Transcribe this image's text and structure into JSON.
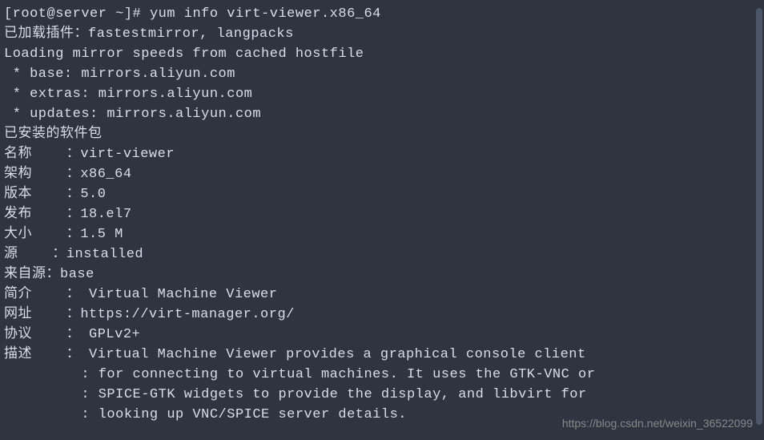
{
  "prompt": {
    "user_host": "[root@server ~]# ",
    "command": "yum info virt-viewer.x86_64"
  },
  "output": {
    "plugins_loaded": "已加载插件：fastestmirror, langpacks",
    "loading_mirror": "Loading mirror speeds from cached hostfile",
    "mirror_base": " * base: mirrors.aliyun.com",
    "mirror_extras": " * extras: mirrors.aliyun.com",
    "mirror_updates": " * updates: mirrors.aliyun.com",
    "installed_header": "已安装的软件包",
    "name_label": "名称    ：",
    "name_value": "virt-viewer",
    "arch_label": "架构    ：",
    "arch_value": "x86_64",
    "version_label": "版本    ：",
    "version_value": "5.0",
    "release_label": "发布    ：",
    "release_value": "18.el7",
    "size_label": "大小    ：",
    "size_value": "1.5 M",
    "source_label": "源    ：",
    "source_value": "installed",
    "from_source_label": "来自源：",
    "from_source_value": "base",
    "summary_label": "简介    ： ",
    "summary_value": "Virtual Machine Viewer",
    "url_label": "网址    ：",
    "url_value": "https://virt-manager.org/",
    "license_label": "协议    ： ",
    "license_value": "GPLv2+",
    "desc_label": "描述    ： ",
    "desc_line1": "Virtual Machine Viewer provides a graphical console client",
    "desc_cont": "         : ",
    "desc_line2": "for connecting to virtual machines. It uses the GTK-VNC or",
    "desc_line3": "SPICE-GTK widgets to provide the display, and libvirt for",
    "desc_line4": "looking up VNC/SPICE server details."
  },
  "watermark": "https://blog.csdn.net/weixin_36522099"
}
